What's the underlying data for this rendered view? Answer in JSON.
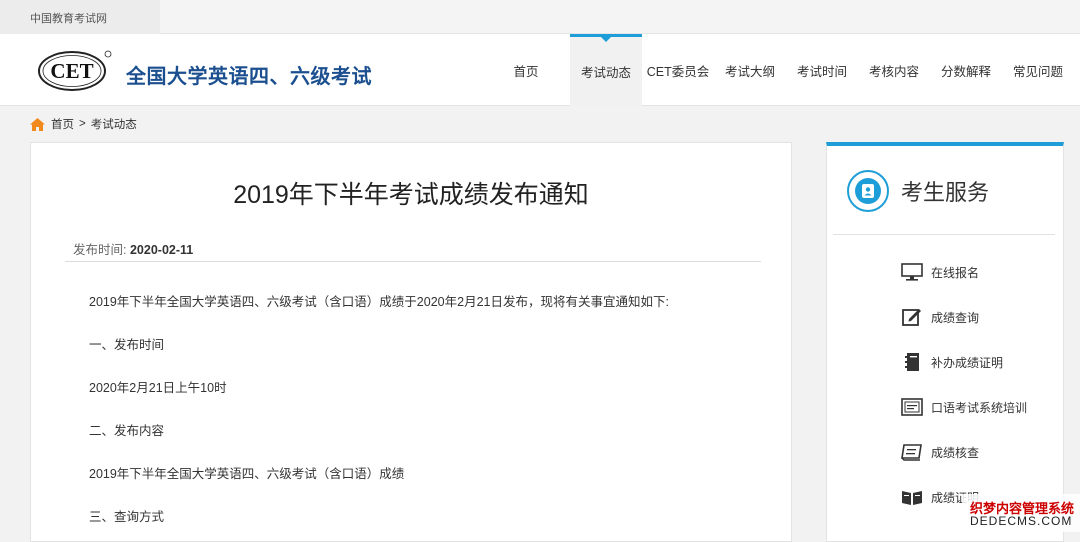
{
  "topbar": {
    "site_name": "中国教育考试网"
  },
  "header": {
    "logo_text": "CET",
    "brand": "全国大学英语四、六级考试",
    "nav": [
      {
        "label": "首页",
        "active": false
      },
      {
        "label": "考试动态",
        "active": true
      },
      {
        "label": "CET委员会",
        "active": false
      },
      {
        "label": "考试大纲",
        "active": false
      },
      {
        "label": "考试时间",
        "active": false
      },
      {
        "label": "考核内容",
        "active": false
      },
      {
        "label": "分数解释",
        "active": false
      },
      {
        "label": "常见问题",
        "active": false
      }
    ]
  },
  "breadcrumb": {
    "home": "首页",
    "separator": ">",
    "current": "考试动态"
  },
  "article": {
    "title": "2019年下半年考试成绩发布通知",
    "date_label": "发布时间:",
    "date": "2020-02-11",
    "paragraphs": [
      "2019年下半年全国大学英语四、六级考试（含口语）成绩于2020年2月21日发布，现将有关事宜通知如下:",
      "一、发布时间",
      "2020年2月21日上午10时",
      "二、发布内容",
      "2019年下半年全国大学英语四、六级考试（含口语）成绩",
      "三、查询方式"
    ]
  },
  "sidebar": {
    "title": "考生服务",
    "items": [
      {
        "label": "在线报名",
        "icon": "monitor-icon"
      },
      {
        "label": "成绩查询",
        "icon": "edit-icon"
      },
      {
        "label": "补办成绩证明",
        "icon": "notebook-icon"
      },
      {
        "label": "口语考试系统培训",
        "icon": "screen-icon"
      },
      {
        "label": "成绩核查",
        "icon": "book-icon"
      },
      {
        "label": "成绩证明",
        "icon": "open-book-icon"
      }
    ]
  },
  "watermark": {
    "line1": "织梦内容管理系统",
    "line2": "DEDECMS.COM"
  },
  "colors": {
    "accent": "#1e9ed8",
    "brand": "#1b4f8f"
  }
}
